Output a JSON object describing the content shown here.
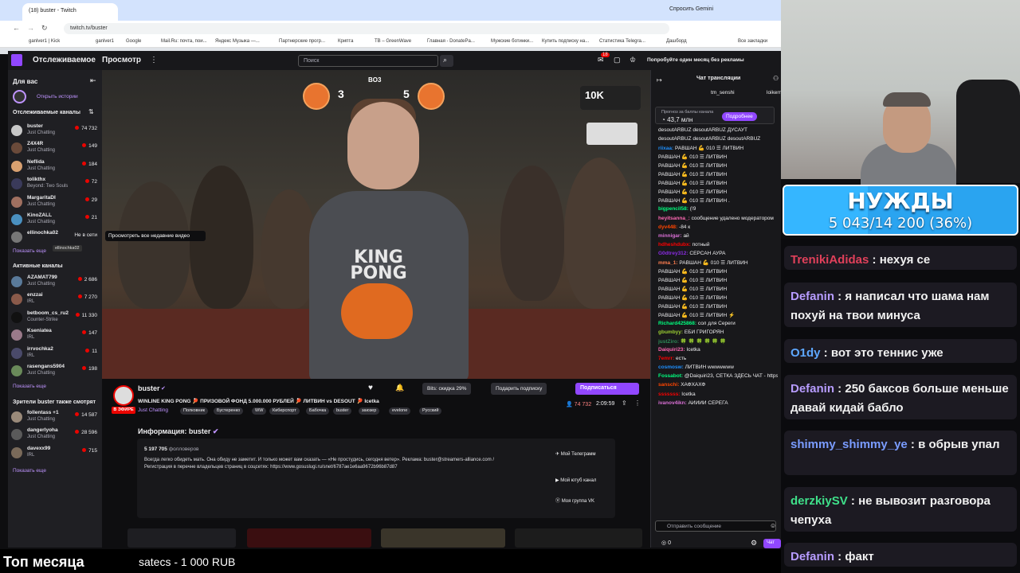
{
  "browser": {
    "tab_title": "(18) buster - Twitch",
    "gemini_label": "Спросить Gemini",
    "url": "twitch.tv/buster",
    "bookmarks": [
      "ganlver1 | Kick",
      "ganlver1",
      "Google",
      "Mail.Ru: почта, пои...",
      "Яндекс Музыка —...",
      "Партнерские прогр...",
      "Крипта",
      "TB – GreenWave",
      "Главная - DonatePa...",
      "Мужские ботинки...",
      "Купить подписку на...",
      "Статистика Telegra...",
      "Дашборд",
      "Все закладки"
    ]
  },
  "nav": {
    "following": "Отслеживаемое",
    "browse": "Просмотр",
    "search_placeholder": "Поиск",
    "notif_count": "18",
    "promo": "Попробуйте один месяц без рекламы"
  },
  "sidebar": {
    "for_you": "Для вас",
    "open_stories": "Открыть истории",
    "followed_header": "Отслеживаемые каналы",
    "followed": [
      {
        "name": "buster",
        "cat": "Just Chatting",
        "viewers": "74 732",
        "color": "#c8c8c8"
      },
      {
        "name": "Z4X4R",
        "cat": "Just Chatting",
        "viewers": "149",
        "color": "#6a4a3a"
      },
      {
        "name": "Neflida",
        "cat": "Just Chatting",
        "viewers": "184",
        "color": "#d8a070"
      },
      {
        "name": "tolikthx",
        "cat": "Beyond: Two Souls",
        "viewers": "72",
        "color": "#3a3a5a"
      },
      {
        "name": "MargaritaDI",
        "cat": "Just Chatting",
        "viewers": "29",
        "color": "#a07060"
      },
      {
        "name": "KinoZALL",
        "cat": "Just Chatting",
        "viewers": "21",
        "color": "#4a90c0"
      },
      {
        "name": "ellinochka02",
        "cat": "",
        "viewers": "Не в сети",
        "color": "#777777"
      }
    ],
    "show_more": "Показать еще",
    "offline_tooltip": "ellinochka02",
    "active_header": "Активные каналы",
    "active": [
      {
        "name": "AZAMAT799",
        "cat": "Just Chatting",
        "viewers": "2 686",
        "color": "#5a7a9a"
      },
      {
        "name": "enzzai",
        "cat": "IRL",
        "viewers": "7 270",
        "color": "#8a5a4a"
      },
      {
        "name": "betboom_cs_ru2",
        "cat": "Counter-Strike",
        "viewers": "11 330",
        "color": "#111111"
      },
      {
        "name": "Kseniatea",
        "cat": "IRL",
        "viewers": "147",
        "color": "#9a7a8a"
      },
      {
        "name": "irrvochka2",
        "cat": "IRL",
        "viewers": "11",
        "color": "#4a4a6a"
      },
      {
        "name": "rasengans5904",
        "cat": "Just Chatting",
        "viewers": "198",
        "color": "#6a8a5a"
      }
    ],
    "show_more2": "Показать еще",
    "viewers_also": "Зрители buster также смотрят",
    "also": [
      {
        "name": "follentass +1",
        "cat": "Just Chatting",
        "viewers": "14 587",
        "color": "#9a8a7a"
      },
      {
        "name": "dangerlyoha",
        "cat": "Just Chatting",
        "viewers": "28 596",
        "color": "#5a5a5a"
      },
      {
        "name": "davexx99",
        "cat": "IRL",
        "viewers": "715",
        "color": "#7a6a5a"
      }
    ],
    "show_more3": "Показать еще"
  },
  "video": {
    "tooltip": "Просмотреть все недавние видео",
    "score_left": "3",
    "score_right": "5",
    "score_label": "BO3",
    "shirt_text": "KING PONG",
    "promo_badge": "10K"
  },
  "stream": {
    "streamer": "buster",
    "live_badge": "В ЭФИРЕ",
    "title": "WINLINE KING PONG 🏓 ПРИЗОВОЙ ФОНД 5.000.000 РУБЛЕЙ 🏓 ЛИТВИН vs DESOUT 🏓 Icetka",
    "category": "Just Chatting",
    "tags": [
      "Полковник",
      "Бустеренко",
      "WW",
      "Киберспорт",
      "Бабочка",
      "buster",
      "заюзер",
      "evelone",
      "Русский"
    ],
    "viewers": "74 732",
    "uptime": "2:09:59",
    "bits_label": "Bits: скидка 29%",
    "gift_label": "Подарить подписку",
    "subscribe_label": "Подписаться",
    "about_title": "Информация: buster",
    "followers": "5 197 705",
    "followers_label": "фолловеров",
    "bio": "Всегда легко обидеть мать. Она обиду не заметит. И только может вам сказать — «Не простудись, сегодня ветер». Реклама: buster@streamers-alliance.com / Регистрация в перечне владельцев страниц в соцсетях: https://www.gosuslugi.ru/snet/6787ae1e6aa9672b96b87d87",
    "links": [
      "Мой Телеграмм",
      "Мой ютуб канал",
      "Моя группа VK"
    ]
  },
  "chat": {
    "header": "Чат трансляции",
    "pinned_user": "tm_senshi",
    "pinned_user2": "loikerry",
    "prediction": "43,7 млн",
    "prediction_more": "Подробнее",
    "prediction_label": "Прогноз за баллы канала",
    "lines": [
      {
        "u": "",
        "t": "desoutARBUZ desoutARBUZ ДУСАУТ",
        "c": "#efeff1"
      },
      {
        "u": "",
        "t": "desoutARBUZ desoutARBUZ desoutARBUZ",
        "c": "#efeff1"
      },
      {
        "u": "riixaa:",
        "t": "РАВШАН 💪 010 ☰ ЛИТВИН",
        "c": "#1e90ff"
      },
      {
        "u": "",
        "t": "РАВШАН 💪 010 ☰ ЛИТВИН",
        "c": "#efeff1"
      },
      {
        "u": "",
        "t": "РАВШАН 💪 010 ☰ ЛИТВИН",
        "c": "#efeff1"
      },
      {
        "u": "",
        "t": "РАВШАН 💪 010 ☰ ЛИТВИН",
        "c": "#efeff1"
      },
      {
        "u": "",
        "t": "РАВШАН 💪 010 ☰ ЛИТВИН",
        "c": "#efeff1"
      },
      {
        "u": "",
        "t": "РАВШАН 💪 010 ☰ ЛИТВИН",
        "c": "#efeff1"
      },
      {
        "u": "",
        "t": "РАВШАН 💪 010 ☰ ЛИТВИН .",
        "c": "#efeff1"
      },
      {
        "u": "bigpencil58:",
        "t": "(!9",
        "c": "#00ff7f"
      },
      {
        "u": "heyitsanna_:",
        "t": "сообщение удалено модератором",
        "c": "#ff69b4"
      },
      {
        "u": "dyv448:",
        "t": "-84 к",
        "c": "#ff4500"
      },
      {
        "u": "minnigar:",
        "t": "ай",
        "c": "#da70d6"
      },
      {
        "u": "hdheshdubx:",
        "t": "потный",
        "c": "#ff0000"
      },
      {
        "u": "G0dtrey312:",
        "t": "СЕРСАН АУРА",
        "c": "#8a2be2"
      },
      {
        "u": "mma_1:",
        "t": "РАВШАН 💪 010 ☰ ЛИТВИН",
        "c": "#ff7f50"
      },
      {
        "u": "",
        "t": "РАВШАН 💪 010 ☰ ЛИТВИН",
        "c": "#efeff1"
      },
      {
        "u": "",
        "t": "РАВШАН 💪 010 ☰ ЛИТВИН",
        "c": "#efeff1"
      },
      {
        "u": "",
        "t": "РАВШАН 💪 010 ☰ ЛИТВИН",
        "c": "#efeff1"
      },
      {
        "u": "",
        "t": "РАВШАН 💪 010 ☰ ЛИТВИН",
        "c": "#efeff1"
      },
      {
        "u": "",
        "t": "РАВШАН 💪 010 ☰ ЛИТВИН",
        "c": "#efeff1"
      },
      {
        "u": "",
        "t": "РАВШАН 💪 010 ☰ ЛИТВИН ⚡",
        "c": "#efeff1"
      },
      {
        "u": "Richard425868:",
        "t": "сол для Сереги",
        "c": "#00ff7f"
      },
      {
        "u": "gbumbyy:",
        "t": "ЕБИ ГРИГОРЯН",
        "c": "#9acd32"
      },
      {
        "u": "justZiro:",
        "t": "🍀 🍀 🍀 🍀 🍀 🍀",
        "c": "#2e8b57"
      },
      {
        "u": "Daiquiri23:",
        "t": "Icetka",
        "c": "#ff69b4"
      },
      {
        "u": "7emrr:",
        "t": "есть",
        "c": "#ff0000"
      },
      {
        "u": "cosmosw:",
        "t": "ЛИТВИН wwwwwww",
        "c": "#1e90ff"
      },
      {
        "u": "Fossabot:",
        "t": "@Daiquiri23, СЕТКА ЗДЕСЬ ЧАТ - https://t.me/winlinekingpong",
        "c": "#00ff7f"
      },
      {
        "u": "sanschi:",
        "t": "ХАФХАХФ",
        "c": "#ff4500"
      },
      {
        "u": "sssssss:",
        "t": "Icetka",
        "c": "#ff0000"
      },
      {
        "u": "ivanov4ikn:",
        "t": "АЙЙЙЙ СЕРЕГА",
        "c": "#da70d6"
      }
    ],
    "input_placeholder": "Отправить сообщение",
    "points": "0",
    "chat_button": "Чат"
  },
  "overlay": {
    "goal_title": "НУЖДЫ",
    "goal_value": "5 043/14 200 (36%)",
    "goal_fraction": 0.36,
    "messages": [
      {
        "u": "TrenikiAdidas",
        "t": "нехуя се",
        "c": "#e0405a"
      },
      {
        "u": "Defanin",
        "t": "я написал что шама нам похуй на твои минуса",
        "c": "#b79cff"
      },
      {
        "u": "O1dy",
        "t": "вот это теннис уже",
        "c": "#5ea8ff"
      },
      {
        "u": "Defanin",
        "t": "250 баксов больше меньше давай кидай бабло",
        "c": "#b79cff"
      },
      {
        "u": "shimmy_shimmy_ye",
        "t": "в обрыв упал",
        "c": "#7a9cff"
      },
      {
        "u": "derzkiySV",
        "t": "не вывозит разговора чепуха",
        "c": "#3fe08a"
      },
      {
        "u": "Defanin",
        "t": "факт",
        "c": "#b79cff"
      }
    ]
  },
  "footer": {
    "top_month": "Топ месяца",
    "donor": "satecs - 1 000 RUB"
  }
}
